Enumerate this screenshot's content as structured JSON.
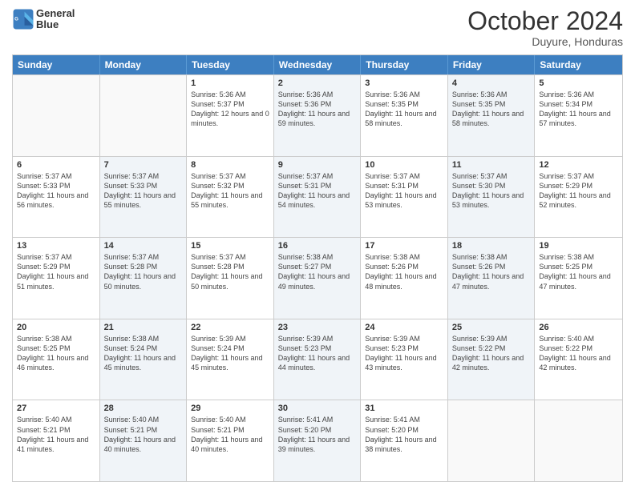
{
  "header": {
    "logo_line1": "General",
    "logo_line2": "Blue",
    "month_title": "October 2024",
    "location": "Duyure, Honduras"
  },
  "days_of_week": [
    "Sunday",
    "Monday",
    "Tuesday",
    "Wednesday",
    "Thursday",
    "Friday",
    "Saturday"
  ],
  "weeks": [
    [
      {
        "day": "",
        "sunrise": "",
        "sunset": "",
        "daylight": "",
        "shaded": false,
        "empty": true
      },
      {
        "day": "",
        "sunrise": "",
        "sunset": "",
        "daylight": "",
        "shaded": false,
        "empty": true
      },
      {
        "day": "1",
        "sunrise": "Sunrise: 5:36 AM",
        "sunset": "Sunset: 5:37 PM",
        "daylight": "Daylight: 12 hours and 0 minutes.",
        "shaded": false,
        "empty": false
      },
      {
        "day": "2",
        "sunrise": "Sunrise: 5:36 AM",
        "sunset": "Sunset: 5:36 PM",
        "daylight": "Daylight: 11 hours and 59 minutes.",
        "shaded": true,
        "empty": false
      },
      {
        "day": "3",
        "sunrise": "Sunrise: 5:36 AM",
        "sunset": "Sunset: 5:35 PM",
        "daylight": "Daylight: 11 hours and 58 minutes.",
        "shaded": false,
        "empty": false
      },
      {
        "day": "4",
        "sunrise": "Sunrise: 5:36 AM",
        "sunset": "Sunset: 5:35 PM",
        "daylight": "Daylight: 11 hours and 58 minutes.",
        "shaded": true,
        "empty": false
      },
      {
        "day": "5",
        "sunrise": "Sunrise: 5:36 AM",
        "sunset": "Sunset: 5:34 PM",
        "daylight": "Daylight: 11 hours and 57 minutes.",
        "shaded": false,
        "empty": false
      }
    ],
    [
      {
        "day": "6",
        "sunrise": "Sunrise: 5:37 AM",
        "sunset": "Sunset: 5:33 PM",
        "daylight": "Daylight: 11 hours and 56 minutes.",
        "shaded": false,
        "empty": false
      },
      {
        "day": "7",
        "sunrise": "Sunrise: 5:37 AM",
        "sunset": "Sunset: 5:33 PM",
        "daylight": "Daylight: 11 hours and 55 minutes.",
        "shaded": true,
        "empty": false
      },
      {
        "day": "8",
        "sunrise": "Sunrise: 5:37 AM",
        "sunset": "Sunset: 5:32 PM",
        "daylight": "Daylight: 11 hours and 55 minutes.",
        "shaded": false,
        "empty": false
      },
      {
        "day": "9",
        "sunrise": "Sunrise: 5:37 AM",
        "sunset": "Sunset: 5:31 PM",
        "daylight": "Daylight: 11 hours and 54 minutes.",
        "shaded": true,
        "empty": false
      },
      {
        "day": "10",
        "sunrise": "Sunrise: 5:37 AM",
        "sunset": "Sunset: 5:31 PM",
        "daylight": "Daylight: 11 hours and 53 minutes.",
        "shaded": false,
        "empty": false
      },
      {
        "day": "11",
        "sunrise": "Sunrise: 5:37 AM",
        "sunset": "Sunset: 5:30 PM",
        "daylight": "Daylight: 11 hours and 53 minutes.",
        "shaded": true,
        "empty": false
      },
      {
        "day": "12",
        "sunrise": "Sunrise: 5:37 AM",
        "sunset": "Sunset: 5:29 PM",
        "daylight": "Daylight: 11 hours and 52 minutes.",
        "shaded": false,
        "empty": false
      }
    ],
    [
      {
        "day": "13",
        "sunrise": "Sunrise: 5:37 AM",
        "sunset": "Sunset: 5:29 PM",
        "daylight": "Daylight: 11 hours and 51 minutes.",
        "shaded": false,
        "empty": false
      },
      {
        "day": "14",
        "sunrise": "Sunrise: 5:37 AM",
        "sunset": "Sunset: 5:28 PM",
        "daylight": "Daylight: 11 hours and 50 minutes.",
        "shaded": true,
        "empty": false
      },
      {
        "day": "15",
        "sunrise": "Sunrise: 5:37 AM",
        "sunset": "Sunset: 5:28 PM",
        "daylight": "Daylight: 11 hours and 50 minutes.",
        "shaded": false,
        "empty": false
      },
      {
        "day": "16",
        "sunrise": "Sunrise: 5:38 AM",
        "sunset": "Sunset: 5:27 PM",
        "daylight": "Daylight: 11 hours and 49 minutes.",
        "shaded": true,
        "empty": false
      },
      {
        "day": "17",
        "sunrise": "Sunrise: 5:38 AM",
        "sunset": "Sunset: 5:26 PM",
        "daylight": "Daylight: 11 hours and 48 minutes.",
        "shaded": false,
        "empty": false
      },
      {
        "day": "18",
        "sunrise": "Sunrise: 5:38 AM",
        "sunset": "Sunset: 5:26 PM",
        "daylight": "Daylight: 11 hours and 47 minutes.",
        "shaded": true,
        "empty": false
      },
      {
        "day": "19",
        "sunrise": "Sunrise: 5:38 AM",
        "sunset": "Sunset: 5:25 PM",
        "daylight": "Daylight: 11 hours and 47 minutes.",
        "shaded": false,
        "empty": false
      }
    ],
    [
      {
        "day": "20",
        "sunrise": "Sunrise: 5:38 AM",
        "sunset": "Sunset: 5:25 PM",
        "daylight": "Daylight: 11 hours and 46 minutes.",
        "shaded": false,
        "empty": false
      },
      {
        "day": "21",
        "sunrise": "Sunrise: 5:38 AM",
        "sunset": "Sunset: 5:24 PM",
        "daylight": "Daylight: 11 hours and 45 minutes.",
        "shaded": true,
        "empty": false
      },
      {
        "day": "22",
        "sunrise": "Sunrise: 5:39 AM",
        "sunset": "Sunset: 5:24 PM",
        "daylight": "Daylight: 11 hours and 45 minutes.",
        "shaded": false,
        "empty": false
      },
      {
        "day": "23",
        "sunrise": "Sunrise: 5:39 AM",
        "sunset": "Sunset: 5:23 PM",
        "daylight": "Daylight: 11 hours and 44 minutes.",
        "shaded": true,
        "empty": false
      },
      {
        "day": "24",
        "sunrise": "Sunrise: 5:39 AM",
        "sunset": "Sunset: 5:23 PM",
        "daylight": "Daylight: 11 hours and 43 minutes.",
        "shaded": false,
        "empty": false
      },
      {
        "day": "25",
        "sunrise": "Sunrise: 5:39 AM",
        "sunset": "Sunset: 5:22 PM",
        "daylight": "Daylight: 11 hours and 42 minutes.",
        "shaded": true,
        "empty": false
      },
      {
        "day": "26",
        "sunrise": "Sunrise: 5:40 AM",
        "sunset": "Sunset: 5:22 PM",
        "daylight": "Daylight: 11 hours and 42 minutes.",
        "shaded": false,
        "empty": false
      }
    ],
    [
      {
        "day": "27",
        "sunrise": "Sunrise: 5:40 AM",
        "sunset": "Sunset: 5:21 PM",
        "daylight": "Daylight: 11 hours and 41 minutes.",
        "shaded": false,
        "empty": false
      },
      {
        "day": "28",
        "sunrise": "Sunrise: 5:40 AM",
        "sunset": "Sunset: 5:21 PM",
        "daylight": "Daylight: 11 hours and 40 minutes.",
        "shaded": true,
        "empty": false
      },
      {
        "day": "29",
        "sunrise": "Sunrise: 5:40 AM",
        "sunset": "Sunset: 5:21 PM",
        "daylight": "Daylight: 11 hours and 40 minutes.",
        "shaded": false,
        "empty": false
      },
      {
        "day": "30",
        "sunrise": "Sunrise: 5:41 AM",
        "sunset": "Sunset: 5:20 PM",
        "daylight": "Daylight: 11 hours and 39 minutes.",
        "shaded": true,
        "empty": false
      },
      {
        "day": "31",
        "sunrise": "Sunrise: 5:41 AM",
        "sunset": "Sunset: 5:20 PM",
        "daylight": "Daylight: 11 hours and 38 minutes.",
        "shaded": false,
        "empty": false
      },
      {
        "day": "",
        "sunrise": "",
        "sunset": "",
        "daylight": "",
        "shaded": false,
        "empty": true
      },
      {
        "day": "",
        "sunrise": "",
        "sunset": "",
        "daylight": "",
        "shaded": false,
        "empty": true
      }
    ]
  ]
}
